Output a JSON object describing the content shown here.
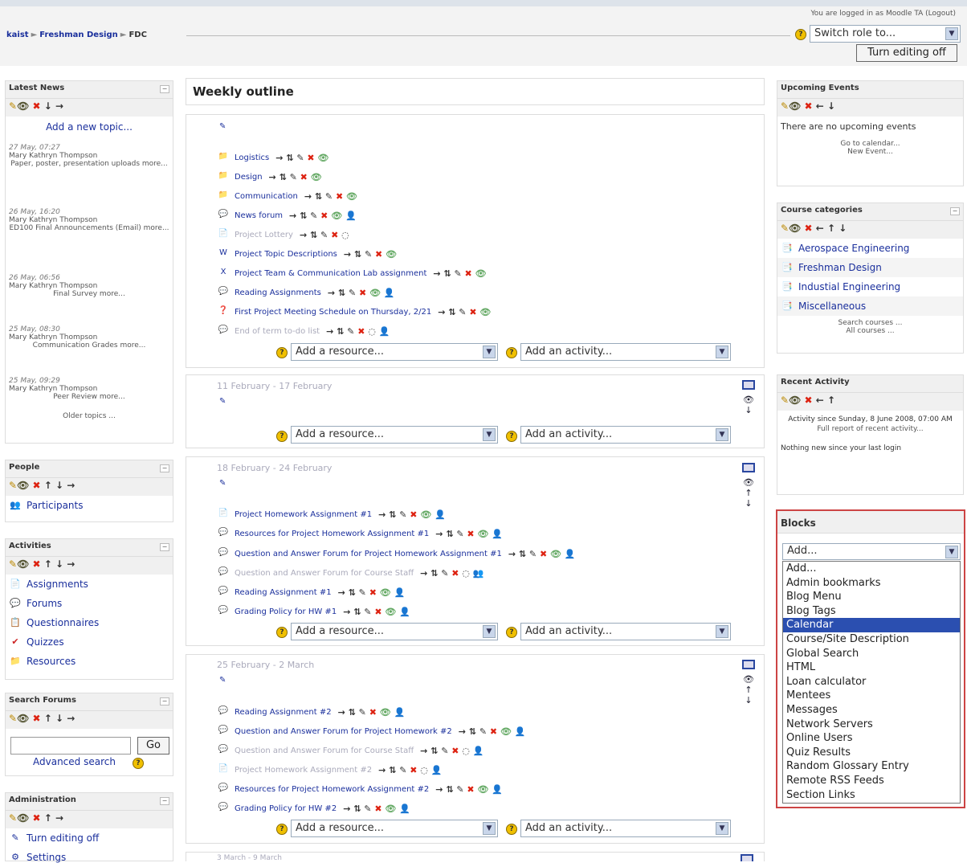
{
  "header": {
    "login_text": "You are logged in as Moodle TA (Logout)",
    "breadcrumb": [
      "kaist",
      "Freshman Design",
      "FDC"
    ],
    "switch_role": "Switch role to...",
    "turn_editing_off": "Turn editing off"
  },
  "latest_news": {
    "title": "Latest News",
    "add_topic": "Add a new topic...",
    "items": [
      {
        "date": "27 May, 07:27",
        "author": "Mary Kathryn Thompson",
        "text": "Paper, poster, presentation uploads more..."
      },
      {
        "date": "26 May, 16:20",
        "author": "Mary Kathryn Thompson",
        "text": "ED100 Final Announcements (Email) more..."
      },
      {
        "date": "26 May, 06:56",
        "author": "Mary Kathryn Thompson",
        "text": "Final Survey more..."
      },
      {
        "date": "25 May, 08:30",
        "author": "Mary Kathryn Thompson",
        "text": "Communication Grades more..."
      },
      {
        "date": "25 May, 09:29",
        "author": "Mary Kathryn Thompson",
        "text": "Peer Review more..."
      }
    ],
    "older": "Older topics ..."
  },
  "people": {
    "title": "People",
    "participants": "Participants"
  },
  "activities": {
    "title": "Activities",
    "items": [
      "Assignments",
      "Forums",
      "Questionnaires",
      "Quizzes",
      "Resources"
    ]
  },
  "search_forums": {
    "title": "Search Forums",
    "go": "Go",
    "advanced": "Advanced search"
  },
  "administration": {
    "title": "Administration",
    "items": [
      "Turn editing off",
      "Settings"
    ]
  },
  "outline": {
    "title": "Weekly outline",
    "add_resource": "Add a resource...",
    "add_activity": "Add an activity...",
    "section0": [
      "Logistics",
      "Design",
      "Communication",
      "News forum",
      "Project Lottery",
      "Project Topic Descriptions",
      "Project Team & Communication Lab assignment",
      "Reading Assignments",
      "First Project Meeting Schedule on Thursday, 2/21",
      "End of term to-do list"
    ],
    "week1_date": "11 February - 17 February",
    "week2_date": "18 February - 24 February",
    "week2": [
      "Project Homework Assignment #1",
      "Resources for Project Homework Assignment #1",
      "Question and Answer Forum for Project Homework Assignment #1",
      "Question and Answer Forum for Course Staff",
      "Reading Assignment #1",
      "Grading Policy for HW #1"
    ],
    "week3_date": "25 February - 2 March",
    "week3": [
      "Reading Assignment #2",
      "Question and Answer Forum for Project Homework #2",
      "Question and Answer Forum for Course Staff",
      "Project Homework Assignment #2",
      "Resources for Project Homework Assignment #2",
      "Grading Policy for HW #2"
    ],
    "week4_date": "3 March - 9 March"
  },
  "upcoming": {
    "title": "Upcoming Events",
    "none": "There are no upcoming events",
    "goto": "Go to calendar...",
    "new_event": "New Event..."
  },
  "categories": {
    "title": "Course categories",
    "items": [
      "Aerospace Engineering",
      "Freshman Design",
      "Industial Engineering",
      "Miscellaneous"
    ],
    "search": "Search courses ...",
    "all": "All courses ..."
  },
  "recent": {
    "title": "Recent Activity",
    "since": "Activity since Sunday, 8 June 2008, 07:00 AM",
    "full": "Full report of recent activity...",
    "nothing": "Nothing new since your last login"
  },
  "blocks": {
    "title": "Blocks",
    "selected": "Add...",
    "options": [
      "Add...",
      "Admin bookmarks",
      "Blog Menu",
      "Blog Tags",
      "Calendar",
      "Course/Site Description",
      "Global Search",
      "HTML",
      "Loan calculator",
      "Mentees",
      "Messages",
      "Network Servers",
      "Online Users",
      "Quiz Results",
      "Random Glossary Entry",
      "Remote RSS Feeds",
      "Section Links"
    ],
    "highlighted": "Calendar"
  }
}
